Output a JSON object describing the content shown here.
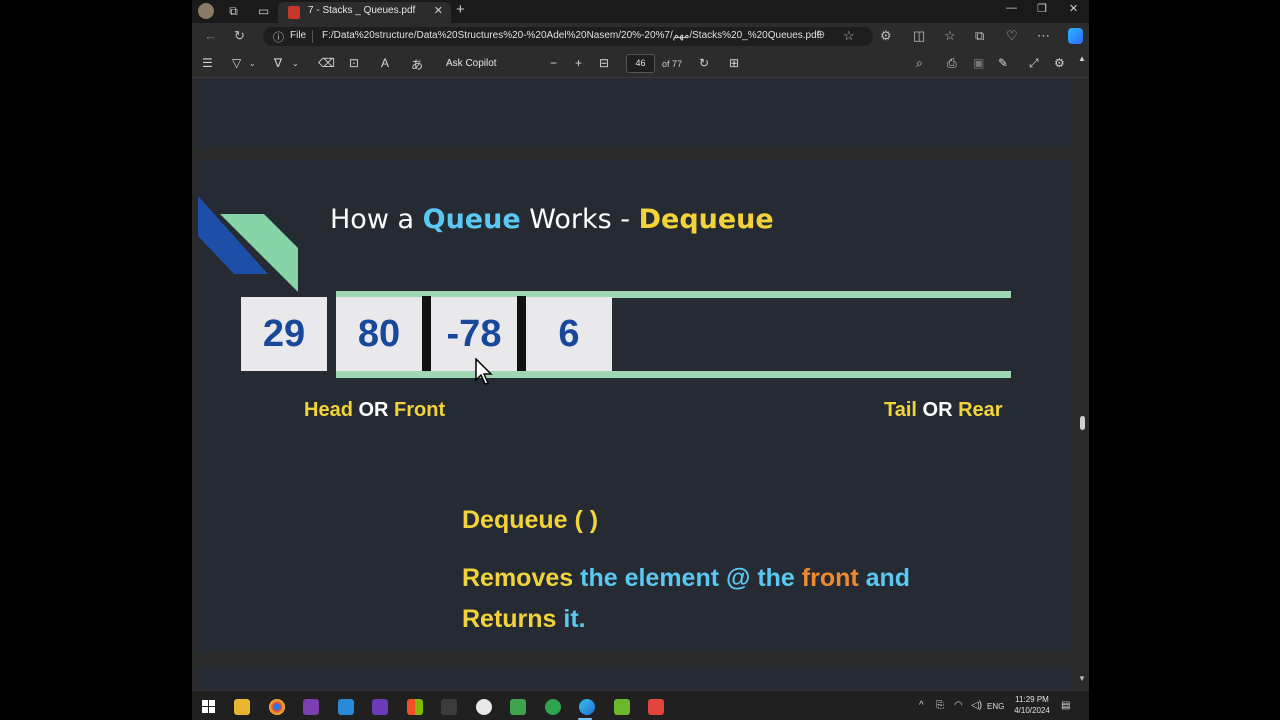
{
  "browser": {
    "tab_title": "7 - Stacks _ Queues.pdf",
    "address_scheme": "File",
    "address_path": "F:/Data%20structure/Data%20Structures%20-%20Adel%20Nasem/20%-20%7/مهم/Stacks%20_%20Queues.pdf"
  },
  "pdf_toolbar": {
    "ask_copilot": "Ask Copilot",
    "page_number": "46",
    "page_total": "of 77"
  },
  "slide": {
    "title_prefix": "How a ",
    "title_keyword1": "Queue",
    "title_middle": " Works - ",
    "title_keyword2": "Deque‌ue",
    "queue_values": [
      "29",
      "80",
      "-78",
      "6"
    ],
    "head_label": "Head",
    "head_or": " OR ",
    "head_alt": "Front",
    "tail_label": "Tail",
    "tail_or": " OR ",
    "tail_alt": "Rear",
    "method": "Dequeue (  )",
    "desc_w1": "Removes",
    "desc_w2": " the element @ the ",
    "desc_w3": "front",
    "desc_w4": " and",
    "desc_w5": "Returns",
    "desc_w6": " it."
  },
  "taskbar": {
    "language": "ENG",
    "time": "11:29 PM",
    "date": "4/10/2024"
  },
  "colors": {
    "slide_bg": "#252a33",
    "accent_blue": "#5ac8f0",
    "accent_yellow": "#f2d43a",
    "accent_orange": "#f08a2e",
    "rail_green": "#9ed7b2",
    "cell_text": "#17489a"
  }
}
